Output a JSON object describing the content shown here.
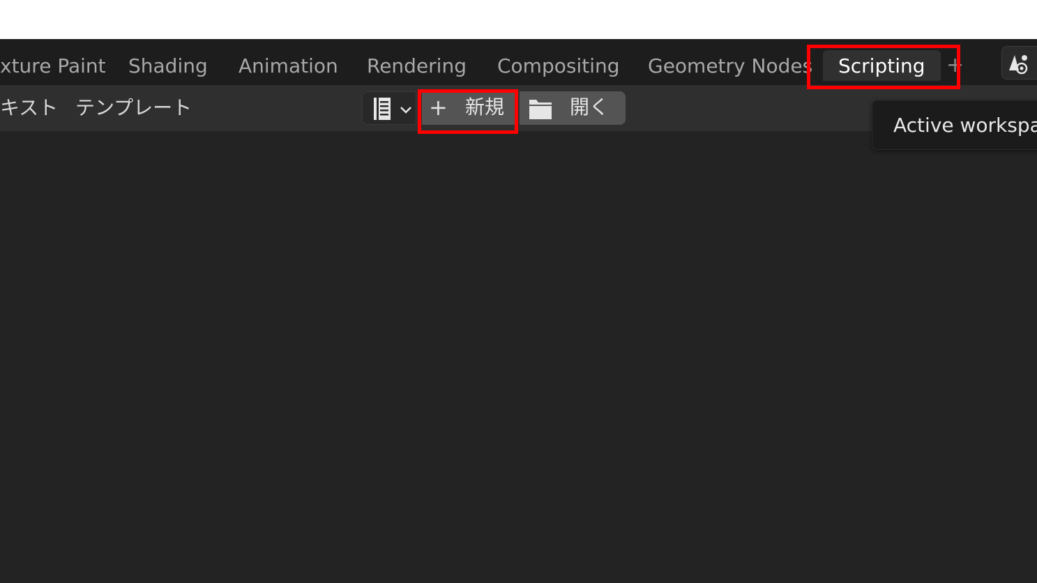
{
  "workspace_tabs": [
    {
      "label": "xture Paint"
    },
    {
      "label": "Shading"
    },
    {
      "label": "Animation"
    },
    {
      "label": "Rendering"
    },
    {
      "label": "Compositing"
    },
    {
      "label": "Geometry Nodes"
    },
    {
      "label": "Scripting",
      "active": true
    }
  ],
  "add_tab_label": "+",
  "header_menu": [
    {
      "label": "キスト"
    },
    {
      "label": "テンプレート"
    }
  ],
  "text_datablock": {
    "browse_icon": "text-document-icon",
    "dropdown_icon": "chevron-down-icon",
    "new_label": "新規",
    "new_icon": "plus-icon",
    "open_label": "開く",
    "open_icon": "folder-icon"
  },
  "tooltip": {
    "text": "Active workspac"
  },
  "colors": {
    "highlight": "#ff0000",
    "editor_bg": "#232323",
    "header_bg": "#2f2f2f",
    "tabbar_bg": "#1d1d1d"
  }
}
